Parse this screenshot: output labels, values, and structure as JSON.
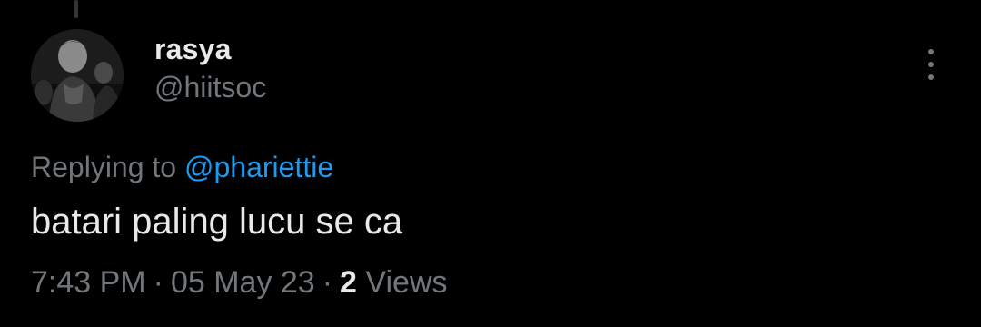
{
  "tweet": {
    "author": {
      "display_name": "rasya",
      "handle": "@hiitsoc"
    },
    "more_icon": "more-vertical-icon",
    "replying_to_label": "Replying to",
    "replying_to_handle": "@phariettie",
    "text": "batari paling lucu se ca",
    "meta": {
      "time": "7:43 PM",
      "separator": "·",
      "date": "05 May 23",
      "views_count": "2",
      "views_label": "Views"
    }
  },
  "colors": {
    "background": "#000000",
    "primary_text": "#e7e9ea",
    "secondary_text": "#71767b",
    "link": "#1d9bf0"
  }
}
